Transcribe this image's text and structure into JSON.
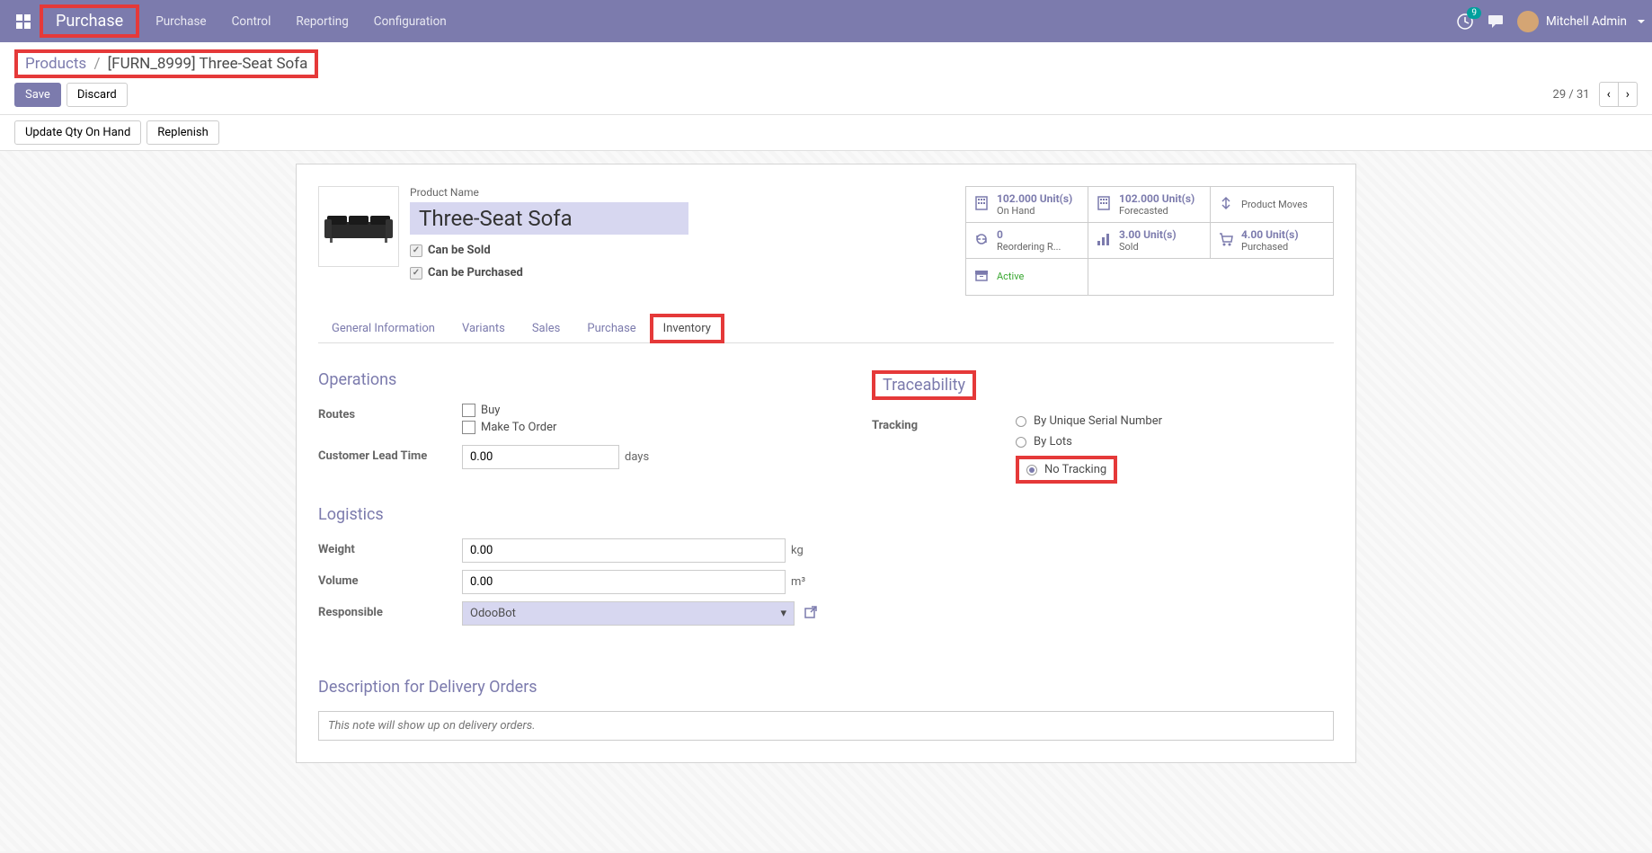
{
  "navbar": {
    "title": "Purchase",
    "menu": [
      "Purchase",
      "Control",
      "Reporting",
      "Configuration"
    ],
    "badge": "9",
    "user_name": "Mitchell Admin"
  },
  "breadcrumb": {
    "link": "Products",
    "sep": "/",
    "current": "[FURN_8999] Three-Seat Sofa"
  },
  "buttons": {
    "save": "Save",
    "discard": "Discard",
    "update_qty": "Update Qty On Hand",
    "replenish": "Replenish"
  },
  "pager": {
    "text": "29 / 31"
  },
  "product": {
    "name_label": "Product Name",
    "name_value": "Three-Seat Sofa",
    "can_be_sold": "Can be Sold",
    "can_be_purchased": "Can be Purchased"
  },
  "stats": {
    "on_hand_value": "102.000 Unit(s)",
    "on_hand_label": "On Hand",
    "forecasted_value": "102.000 Unit(s)",
    "forecasted_label": "Forecasted",
    "moves_label": "Product Moves",
    "reorder_value": "0",
    "reorder_label": "Reordering R...",
    "sold_value": "3.00 Unit(s)",
    "sold_label": "Sold",
    "purchased_value": "4.00 Unit(s)",
    "purchased_label": "Purchased",
    "active_label": "Active"
  },
  "tabs": [
    "General Information",
    "Variants",
    "Sales",
    "Purchase",
    "Inventory"
  ],
  "sections": {
    "operations": {
      "title": "Operations",
      "routes_label": "Routes",
      "route_buy": "Buy",
      "route_mto": "Make To Order",
      "lead_time_label": "Customer Lead Time",
      "lead_time_value": "0.00",
      "lead_time_unit": "days"
    },
    "traceability": {
      "title": "Traceability",
      "tracking_label": "Tracking",
      "option_serial": "By Unique Serial Number",
      "option_lots": "By Lots",
      "option_none": "No Tracking"
    },
    "logistics": {
      "title": "Logistics",
      "weight_label": "Weight",
      "weight_value": "0.00",
      "weight_unit": "kg",
      "volume_label": "Volume",
      "volume_value": "0.00",
      "volume_unit": "m³",
      "responsible_label": "Responsible",
      "responsible_value": "OdooBot"
    },
    "description": {
      "title": "Description for Delivery Orders",
      "placeholder": "This note will show up on delivery orders."
    }
  }
}
